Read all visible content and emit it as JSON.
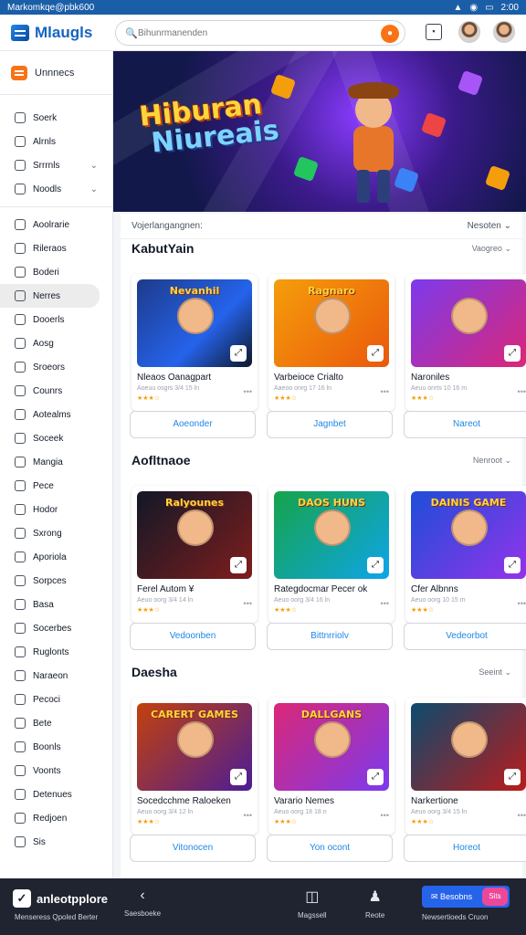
{
  "status": {
    "left": "Markomkqe@pbk600",
    "right": "2:00"
  },
  "header": {
    "logo_text": "Mlaugls",
    "search_placeholder": "Bihunrmanenden"
  },
  "sidebar": {
    "top_label": "Unnnecs",
    "group1": [
      {
        "label": "Soerk"
      },
      {
        "label": "Alrnls"
      },
      {
        "label": "Srrrnls",
        "chevron": true
      },
      {
        "label": "Noodls",
        "chevron": true
      }
    ],
    "group2": [
      {
        "label": "Aoolrarie"
      },
      {
        "label": "Rileraos"
      },
      {
        "label": "Boderi"
      },
      {
        "label": "Nerres",
        "active": true
      },
      {
        "label": "Dooerls"
      },
      {
        "label": "Aosg"
      },
      {
        "label": "Sroeors"
      },
      {
        "label": "Counrs"
      },
      {
        "label": "Aotealms"
      },
      {
        "label": "Soceek"
      },
      {
        "label": "Mangia"
      },
      {
        "label": "Pece"
      },
      {
        "label": "Hodor"
      },
      {
        "label": "Sxrong"
      },
      {
        "label": "Aporiola"
      },
      {
        "label": "Sorpces"
      },
      {
        "label": "Basa"
      },
      {
        "label": "Socerbes"
      },
      {
        "label": "Ruglonts"
      },
      {
        "label": "Naraeon"
      },
      {
        "label": "Pecoci"
      },
      {
        "label": "Bete"
      },
      {
        "label": "Boonls"
      },
      {
        "label": "Voonts"
      },
      {
        "label": "Detenues"
      },
      {
        "label": "Redjoen"
      },
      {
        "label": "Sis"
      }
    ]
  },
  "banner": {
    "line1": "Hiburan",
    "line2": "Niureais"
  },
  "content": {
    "top_left": "Vojerlangangnen:",
    "top_right": "Nesoten",
    "sections": [
      {
        "title": "KabutYain",
        "more": "Vaogreo",
        "cards": [
          {
            "art_title": "Nevanhil",
            "name": "Nleaos Oanagpart",
            "meta": "Aoeuu osgrs  3/4 15 ln",
            "action": "Aoeonder"
          },
          {
            "art_title": "Ragnaro",
            "name": "Varbeioce Crialto",
            "meta": "Aaeoo onrg  17 16 ln",
            "action": "Jagnbet"
          },
          {
            "art_title": "",
            "name": "Naroniles",
            "meta": "Aeuu onrts  10 16 m",
            "action": "Nareot"
          }
        ]
      },
      {
        "title": "Aofltnaoe",
        "more": "Nenroot",
        "cards": [
          {
            "art_title": "Ralyounes",
            "name": "Ferel Autom ¥",
            "meta": "Aeuo oorg  3/4 14 ln",
            "action": "Vedoonben"
          },
          {
            "art_title": "DAOS HUNS",
            "name": "Rategdocmar Pecer ok",
            "meta": "Aeuo oorg  3/4 16 ln",
            "action": "Bittnrriolv"
          },
          {
            "art_title": "DAINIS GAME",
            "name": "Cfer Albnns",
            "meta": "Aeuo oorg  10 15 m",
            "action": "Vedeorbot"
          }
        ]
      },
      {
        "title": "Daesha",
        "more": "Seeint",
        "cards": [
          {
            "art_title": "CARERT GAMES",
            "name": "Socedcchme Raloeken",
            "meta": "Aeuo oorg  3/4 12 ln",
            "action": "Vitonocen"
          },
          {
            "art_title": "DALLGANS",
            "name": "Varario Nemes",
            "meta": "Aeuo oorg  18 18 n",
            "action": "Yon ocont"
          },
          {
            "art_title": "",
            "name": "Narkertione",
            "meta": "Aeuo oorg  3/4 15 ln",
            "action": "Horeot"
          }
        ]
      }
    ]
  },
  "bottom": {
    "brand": "anleotpplore",
    "sub": "Menseress Qpoled Berter",
    "items": [
      {
        "label": "Saesboeke"
      },
      {
        "label": "Magssell"
      },
      {
        "label": "Reote"
      }
    ],
    "cta": "Besobns",
    "badge": "Sits",
    "cta_sub": "Newsertioeds Cruon"
  },
  "colors": {
    "accent": "#1e88e5",
    "status_bar": "#1b5ea8",
    "bottom_bar": "#1f2430",
    "orange": "#f97316"
  }
}
